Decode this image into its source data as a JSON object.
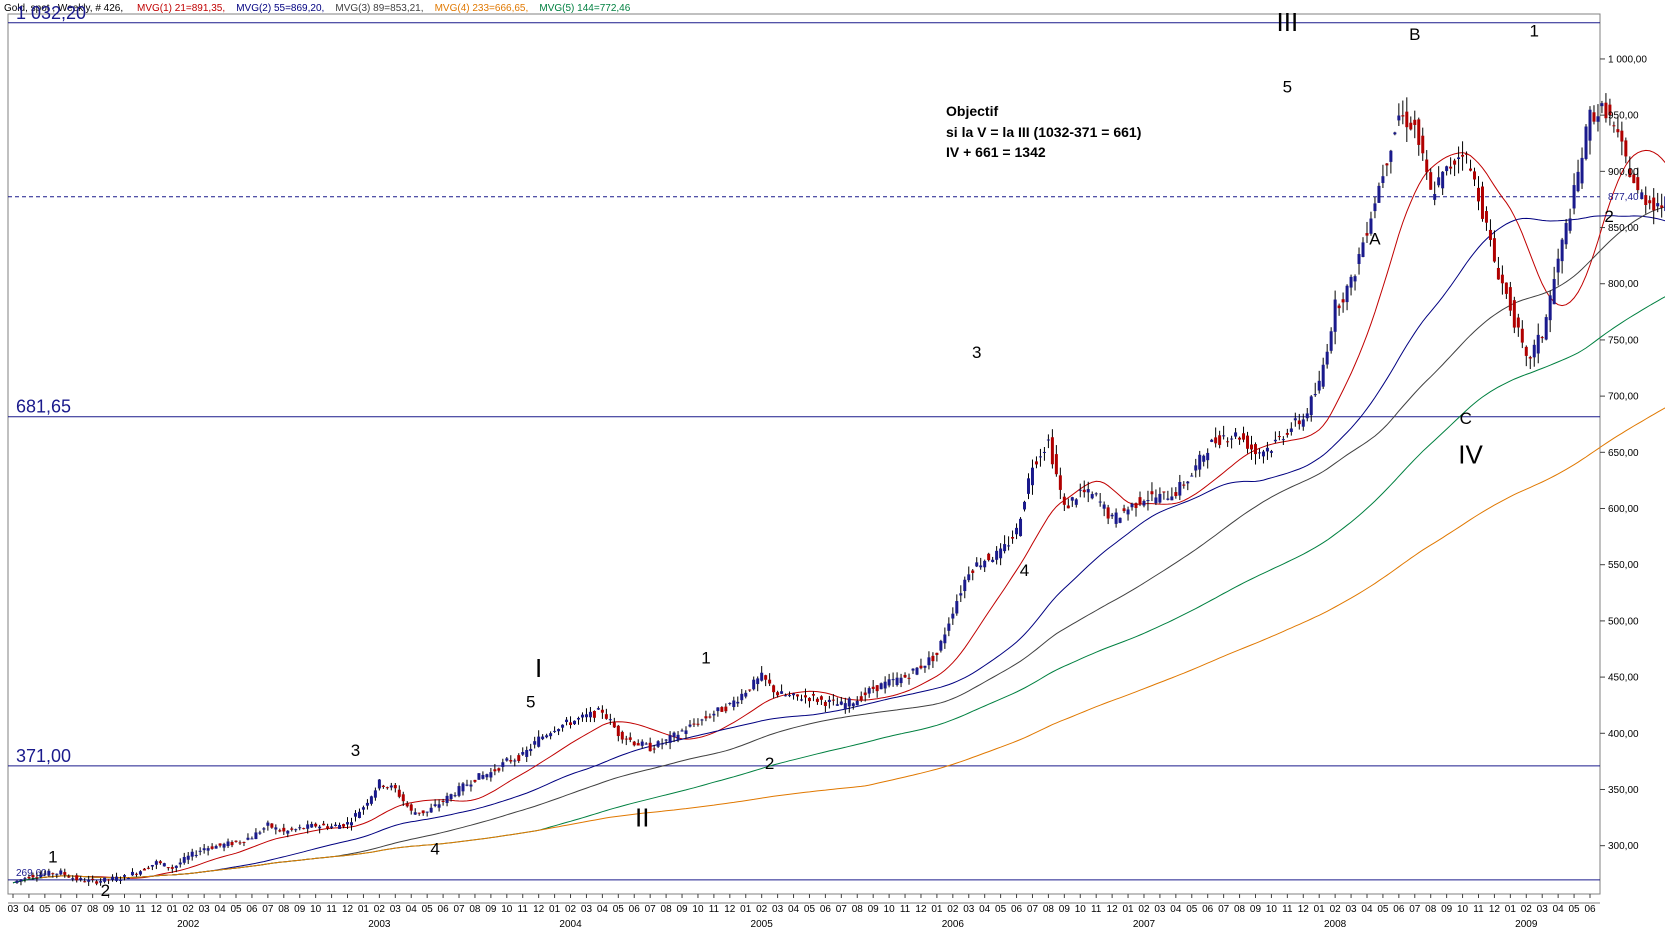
{
  "header": {
    "title": "Gold, spot , Weekly, # 426,",
    "indicators": [
      {
        "label": "MVG(1) 21=891,35,",
        "color": "#c00000"
      },
      {
        "label": "MVG(2) 55=869,20,",
        "color": "#000080"
      },
      {
        "label": "MVG(3) 89=853,21,",
        "color": "#404040"
      },
      {
        "label": "MVG(4) 233=666,65,",
        "color": "#e07800"
      },
      {
        "label": "MVG(5) 144=772,46",
        "color": "#008040"
      }
    ]
  },
  "chart_data": {
    "type": "candlestick",
    "title": "Gold, spot , Weekly",
    "ylim": [
      257,
      1040
    ],
    "y_ticks": [
      "300,00",
      "350,00",
      "400,00",
      "450,00",
      "500,00",
      "550,00",
      "600,00",
      "650,00",
      "700,00",
      "750,00",
      "800,00",
      "850,00",
      "900,00",
      "950,00",
      "1 000,00"
    ],
    "y_tick_values": [
      300,
      350,
      400,
      450,
      500,
      550,
      600,
      650,
      700,
      750,
      800,
      850,
      900,
      950,
      1000
    ],
    "x_months": [
      "03",
      "04",
      "05",
      "06",
      "07",
      "08",
      "09",
      "10",
      "11",
      "12",
      "01",
      "02",
      "03",
      "04",
      "05",
      "06",
      "07",
      "08",
      "09",
      "10",
      "11",
      "12",
      "01",
      "02",
      "03",
      "04",
      "05",
      "06",
      "07",
      "08",
      "09",
      "10",
      "11",
      "12",
      "01",
      "02",
      "03",
      "04",
      "05",
      "06",
      "07",
      "08",
      "09",
      "10",
      "11",
      "12",
      "01",
      "02",
      "03",
      "04",
      "05",
      "06",
      "07",
      "08",
      "09",
      "10",
      "11",
      "12",
      "01",
      "02",
      "03",
      "04",
      "05",
      "06",
      "07",
      "08",
      "09",
      "10",
      "11",
      "12",
      "01",
      "02",
      "03",
      "04",
      "05",
      "06",
      "07",
      "08",
      "09",
      "10",
      "11",
      "12",
      "01",
      "02",
      "03",
      "04",
      "05",
      "06",
      "07",
      "08",
      "09",
      "10",
      "11",
      "12",
      "01",
      "02",
      "03",
      "04",
      "05",
      "06"
    ],
    "x_years": [
      {
        "label": "2002",
        "month_index": 11
      },
      {
        "label": "2003",
        "month_index": 23
      },
      {
        "label": "2004",
        "month_index": 35
      },
      {
        "label": "2005",
        "month_index": 47
      },
      {
        "label": "2006",
        "month_index": 59
      },
      {
        "label": "2007",
        "month_index": 71
      },
      {
        "label": "2008",
        "month_index": 83
      },
      {
        "label": "2009",
        "month_index": 95
      }
    ],
    "monthly_closes": [
      267,
      273,
      275,
      276,
      270,
      268,
      270,
      272,
      278,
      285,
      280,
      290,
      298,
      300,
      303,
      308,
      318,
      312,
      315,
      318,
      317,
      320,
      335,
      356,
      350,
      330,
      330,
      340,
      350,
      360,
      365,
      375,
      380,
      395,
      405,
      410,
      415,
      420,
      400,
      392,
      387,
      393,
      402,
      410,
      418,
      425,
      438,
      450,
      435,
      432,
      432,
      428,
      425,
      430,
      440,
      445,
      450,
      460,
      470,
      510,
      545,
      555,
      560,
      580,
      640,
      660,
      600,
      615,
      610,
      590,
      600,
      610,
      610,
      615,
      630,
      655,
      665,
      665,
      650,
      655,
      670,
      680,
      710,
      780,
      800,
      850,
      900,
      950,
      940,
      880,
      900,
      920,
      880,
      820,
      780,
      730,
      755,
      820,
      880,
      950,
      955,
      920,
      880,
      872,
      870,
      870,
      870
    ],
    "horizontal_levels": [
      {
        "value": 1032.2,
        "label": "1 032,20",
        "style": "solid"
      },
      {
        "value": 681.65,
        "label": "681,65",
        "style": "solid"
      },
      {
        "value": 371.0,
        "label": "371,00",
        "style": "solid"
      },
      {
        "value": 269.6,
        "label": "269,60",
        "style": "solid"
      },
      {
        "value": 877.4,
        "label": "877,40",
        "style": "dashed"
      }
    ],
    "last_price_label": "877,40",
    "moving_averages": [
      {
        "name": "MVG(1) 21",
        "period_weeks": 21,
        "color": "#c00000",
        "last": 891.35
      },
      {
        "name": "MVG(2) 55",
        "period_weeks": 55,
        "color": "#000080",
        "last": 869.2
      },
      {
        "name": "MVG(3) 89",
        "period_weeks": 89,
        "color": "#404040",
        "last": 853.21
      },
      {
        "name": "MVG(5) 144",
        "period_weeks": 144,
        "color": "#008040",
        "last": 772.46
      },
      {
        "name": "MVG(4) 233",
        "period_weeks": 233,
        "color": "#e07800",
        "last": 666.65
      }
    ],
    "annotation_text": [
      "Objectif",
      "si la V = la III  (1032-371 = 661)",
      "IV + 661 = 1342"
    ],
    "wave_labels": [
      {
        "text": "1",
        "month_index": 2.5,
        "price": 285,
        "size": "s"
      },
      {
        "text": "2",
        "month_index": 5.8,
        "price": 255,
        "size": "s"
      },
      {
        "text": "3",
        "month_index": 21.5,
        "price": 380,
        "size": "s"
      },
      {
        "text": "4",
        "month_index": 26.5,
        "price": 292,
        "size": "s"
      },
      {
        "text": "5",
        "month_index": 32.5,
        "price": 423,
        "size": "s"
      },
      {
        "text": "I",
        "month_index": 33,
        "price": 450,
        "size": "l"
      },
      {
        "text": "1",
        "month_index": 43.5,
        "price": 462,
        "size": "s"
      },
      {
        "text": "2",
        "month_index": 47.5,
        "price": 368,
        "size": "s"
      },
      {
        "text": "II",
        "month_index": 39.5,
        "price": 317,
        "size": "l"
      },
      {
        "text": "3",
        "month_index": 60.5,
        "price": 734,
        "size": "s"
      },
      {
        "text": "4",
        "month_index": 63.5,
        "price": 540,
        "size": "s"
      },
      {
        "text": "III",
        "month_index": 80,
        "price": 1025,
        "size": "l"
      },
      {
        "text": "5",
        "month_index": 80,
        "price": 970,
        "size": "s"
      },
      {
        "text": "A",
        "month_index": 85.5,
        "price": 835,
        "size": "s"
      },
      {
        "text": "B",
        "month_index": 88,
        "price": 1017,
        "size": "s"
      },
      {
        "text": "C",
        "month_index": 91.2,
        "price": 675,
        "size": "s"
      },
      {
        "text": "IV",
        "month_index": 91.5,
        "price": 640,
        "size": "l"
      },
      {
        "text": "1",
        "month_index": 95.5,
        "price": 1020,
        "size": "s"
      },
      {
        "text": "2",
        "month_index": 100.2,
        "price": 855,
        "size": "s"
      }
    ]
  }
}
